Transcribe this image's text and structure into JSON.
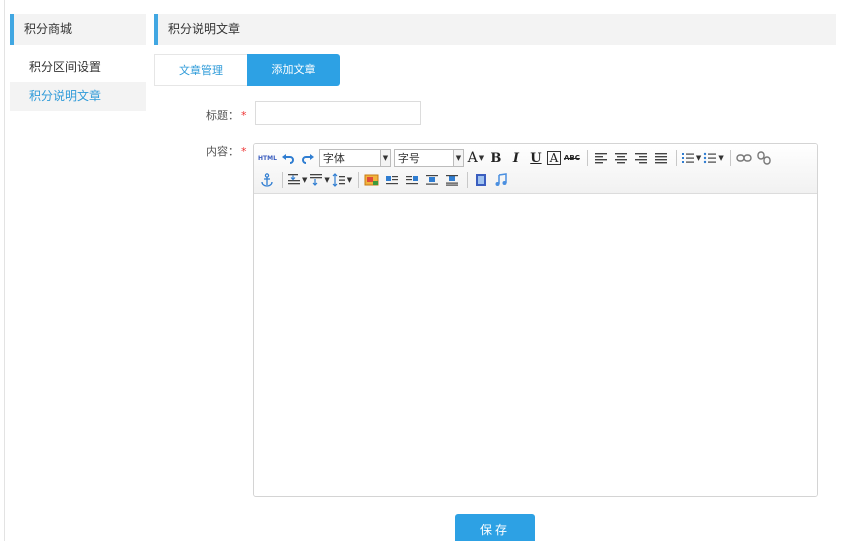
{
  "sidebar": {
    "title": "积分商城",
    "items": [
      {
        "label": "积分区间设置"
      },
      {
        "label": "积分说明文章"
      }
    ]
  },
  "main": {
    "title": "积分说明文章",
    "tabs": [
      {
        "label": "文章管理"
      },
      {
        "label": "添加文章"
      }
    ]
  },
  "form": {
    "title_label": "标题：",
    "title_value": "",
    "content_label": "内容：",
    "required_mark": "*"
  },
  "editor": {
    "html_label": "HTML",
    "font_family": "字体",
    "font_size": "字号",
    "font_color_glyph": "A",
    "bold_glyph": "B",
    "italic_glyph": "I",
    "underline_glyph": "U",
    "bgcolor_glyph": "A",
    "strike_glyph": "ABC",
    "content": ""
  },
  "save_label": "保存",
  "colors": {
    "accent": "#2da1e4",
    "accent_text": "#2f9bd9",
    "panel_bg": "#f3f3f3",
    "required": "#e33333"
  }
}
